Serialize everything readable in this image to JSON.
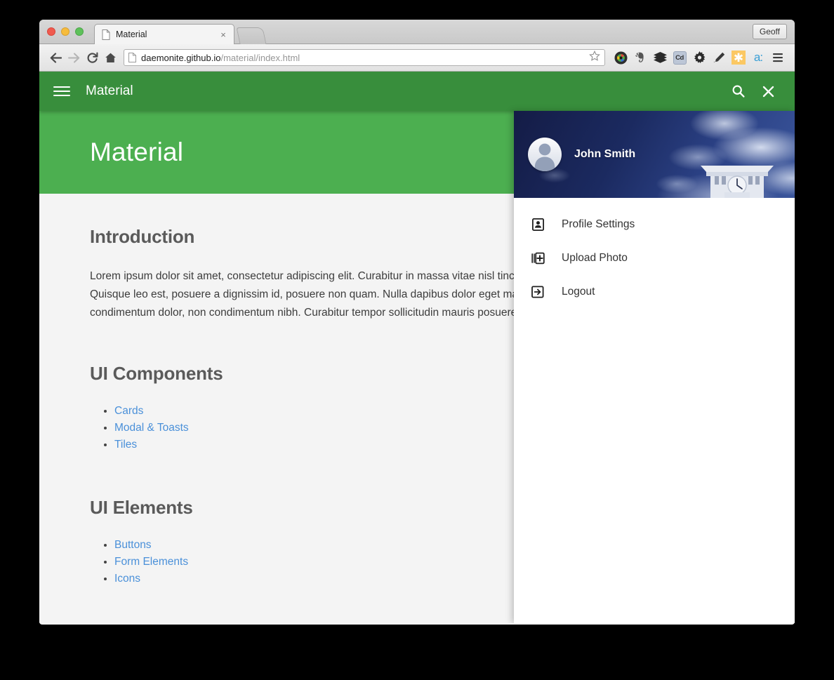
{
  "browser": {
    "tab": {
      "title": "Material",
      "favicon": "document-icon",
      "close": "×"
    },
    "new_tab_label": "",
    "profile_label": "Geoff",
    "nav": {
      "back": "back-arrow-icon",
      "forward": "forward-arrow-icon",
      "reload": "reload-icon",
      "home": "home-icon"
    },
    "omnibox": {
      "favicon": "document-icon",
      "url_domain": "daemonite.github.io",
      "url_path": "/material/index.html",
      "full_url": "daemonite.github.io/material/index.html",
      "star": "bookmark-star-icon"
    },
    "extensions": [
      {
        "name": "camera-lens-icon",
        "label": ""
      },
      {
        "name": "evernote-elephant-icon",
        "label": ""
      },
      {
        "name": "layers-stack-icon",
        "label": ""
      },
      {
        "name": "colorzilla-icon",
        "label": "Cd"
      },
      {
        "name": "gear-icon",
        "label": ""
      },
      {
        "name": "pencil-icon",
        "label": ""
      },
      {
        "name": "asterisk-icon",
        "label": "✱"
      },
      {
        "name": "alexa-rank-icon",
        "label": "a:"
      },
      {
        "name": "chrome-menu-icon",
        "label": ""
      }
    ]
  },
  "app": {
    "toolbar": {
      "menu_icon": "hamburger-menu-icon",
      "title": "Material",
      "search_icon": "search-icon",
      "close_icon": "close-icon",
      "bg_color": "#388e3c"
    },
    "hero": {
      "title": "Material",
      "bg_color": "#4caf50"
    },
    "content": {
      "intro_heading": "Introduction",
      "intro_paragraph": "Lorem ipsum dolor sit amet, consectetur adipiscing elit. Curabitur in massa vitae nisl tincidunt gravida vel purus. Quisque leo est, posuere a dignissim id, posuere non quam. Nulla dapibus dolor eget mauris. Phasellus ultrices condimentum dolor, non condimentum nibh. Curabitur tempor sollicitudin mauris posuere.",
      "sections": [
        {
          "heading": "UI Components",
          "links": [
            "Cards",
            "Modal & Toasts",
            "Tiles"
          ]
        },
        {
          "heading": "UI Elements",
          "links": [
            "Buttons",
            "Form Elements",
            "Icons"
          ]
        }
      ],
      "link_color": "#4a90d9"
    },
    "fabs": [
      {
        "name": "microphone-fab",
        "icon": "microphone-icon",
        "color": "#2196f3"
      },
      {
        "name": "photo-fab",
        "icon": "photo-image-icon",
        "color": "#4caf50"
      },
      {
        "name": "video-fab",
        "icon": "video-camera-icon",
        "color": "#fbc02d"
      },
      {
        "name": "close-fab",
        "icon": "close-x-icon",
        "color": "#f44336"
      }
    ],
    "drawer": {
      "user_name": "John Smith",
      "avatar": "user-avatar-placeholder",
      "header_bg": "clock-tower-sky-photo",
      "items": [
        {
          "label": "Profile Settings",
          "icon": "contact-badge-icon"
        },
        {
          "label": "Upload Photo",
          "icon": "add-to-library-icon"
        },
        {
          "label": "Logout",
          "icon": "exit-arrow-icon"
        }
      ]
    }
  }
}
